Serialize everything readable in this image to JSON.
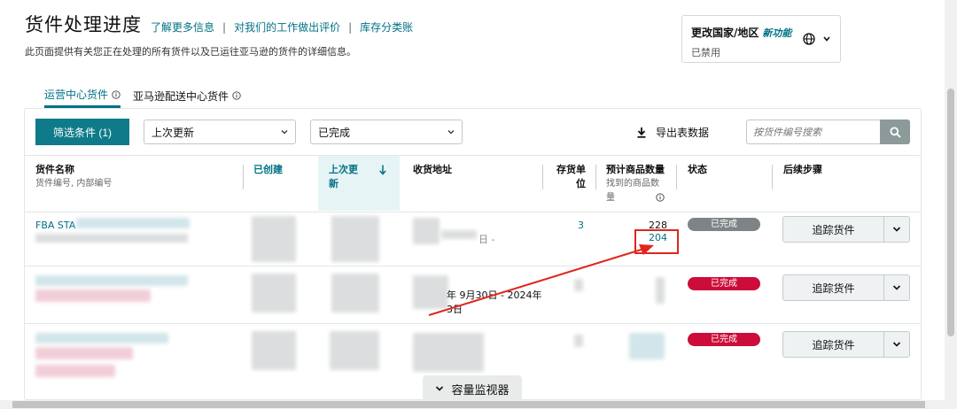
{
  "header": {
    "title": "货件处理进度",
    "links": [
      "了解更多信息",
      "对我们的工作做出评价",
      "库存分类账"
    ],
    "subtitle": "此页面提供有关您正在处理的所有货件以及已运往亚马逊的货件的详细信息。"
  },
  "region": {
    "title": "更改国家/地区",
    "new_badge": "新功能",
    "status": "已禁用",
    "icon": "globe-icon"
  },
  "tabs": [
    {
      "label": "运营中心货件",
      "active": true
    },
    {
      "label": "亚马逊配送中心货件",
      "active": false
    }
  ],
  "toolbar": {
    "filter_label": "筛选条件 (1)",
    "sort_select": "上次更新",
    "status_select": "已完成",
    "export_label": "导出表数据",
    "search_placeholder": "按货件编号搜索"
  },
  "table": {
    "columns": {
      "name": "货件名称",
      "name_sub": "货件编号, 内部编号",
      "created": "已创建",
      "updated": "上次更新",
      "address": "收货地址",
      "sku": "存货单位",
      "qty": "预计商品数量",
      "qty_sub": "找到的商品数量",
      "status": "状态",
      "next": "后续步骤"
    },
    "rows": [
      {
        "name_prefix": "FBA STA",
        "address_fragment": "日 -",
        "sku": "3",
        "expected": "228",
        "found": "204",
        "status": "已完成",
        "action": "追踪货件"
      },
      {
        "name_prefix": "",
        "address_fragment": "年 9月30日 - 2024年",
        "address_fragment2": "3日",
        "sku": "",
        "expected": "",
        "found": "",
        "status": "已完成",
        "action": "追踪货件"
      },
      {
        "name_prefix": "",
        "address_fragment": "",
        "sku": "",
        "expected": "",
        "found": "",
        "status": "已完成",
        "action": "追踪货件"
      }
    ]
  },
  "capacity_monitor": "容量监视器",
  "colors": {
    "accent": "#007185",
    "primary_button": "#0f7b8a",
    "status_gray": "#7e8485",
    "status_red": "#cc0c39",
    "annotation_red": "#e0261c"
  }
}
